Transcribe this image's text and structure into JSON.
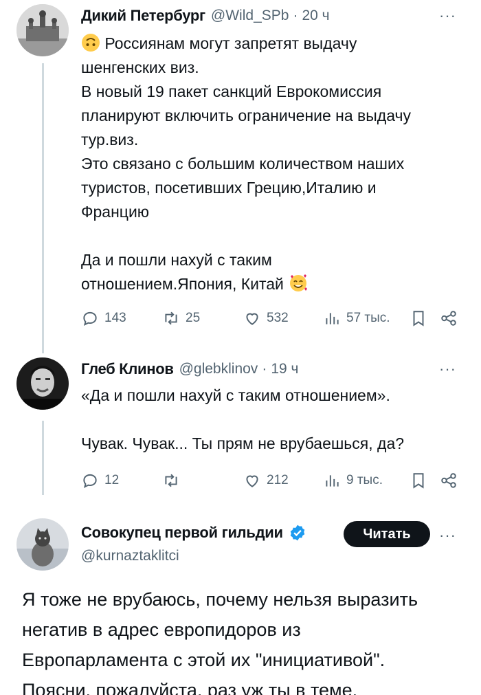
{
  "tweets": [
    {
      "name": "Дикий Петербург",
      "handle": "@Wild_SPb",
      "dot": "·",
      "time": "20 ч",
      "more": "···",
      "lines": [
        "Россиянам могут запретят выдачу",
        "шенгенских виз.",
        "В новый 19 пакет санкций Еврокомиссия",
        "планируют включить ограничение на выдачу",
        "тур.виз.",
        "Это связано с большим количеством наших",
        "туристов, посетивших Грецию,Италию и",
        "Францию",
        "",
        "Да и пошли нахуй с таким",
        "отношением.Япония, Китай"
      ],
      "stats": {
        "replies": "143",
        "retweets": "25",
        "likes": "532",
        "views": "57 тыс."
      }
    },
    {
      "name": "Глеб Клинов",
      "handle": "@glebklinov",
      "dot": "·",
      "time": "19 ч",
      "more": "···",
      "lines": [
        "«Да и пошли нахуй с таким отношением».",
        "",
        "Чувак. Чувак... Ты прям не врубаешься, да?"
      ],
      "stats": {
        "replies": "12",
        "retweets": "",
        "likes": "212",
        "views": "9 тыс."
      }
    },
    {
      "name": "Совокупец первой гильдии",
      "handle": "@kurnaztaklitci",
      "follow_label": "Читать",
      "more": "···",
      "lines": [
        "Я тоже не врубаюсь, почему нельзя выразить",
        "негатив в адрес европидоров из",
        "Европарламента с этой их \"инициативой\".",
        "Поясни, пожалуйста, раз уж ты в теме."
      ]
    }
  ],
  "icons": {
    "reply": "reply-icon",
    "retweet": "retweet-icon",
    "like": "heart-icon",
    "views": "views-icon",
    "bookmark": "bookmark-icon",
    "share": "share-icon",
    "verified": "verified-badge-icon"
  },
  "colors": {
    "text": "#0f1419",
    "muted": "#536471",
    "verified": "#1d9bf0",
    "button": "#0f1419"
  }
}
